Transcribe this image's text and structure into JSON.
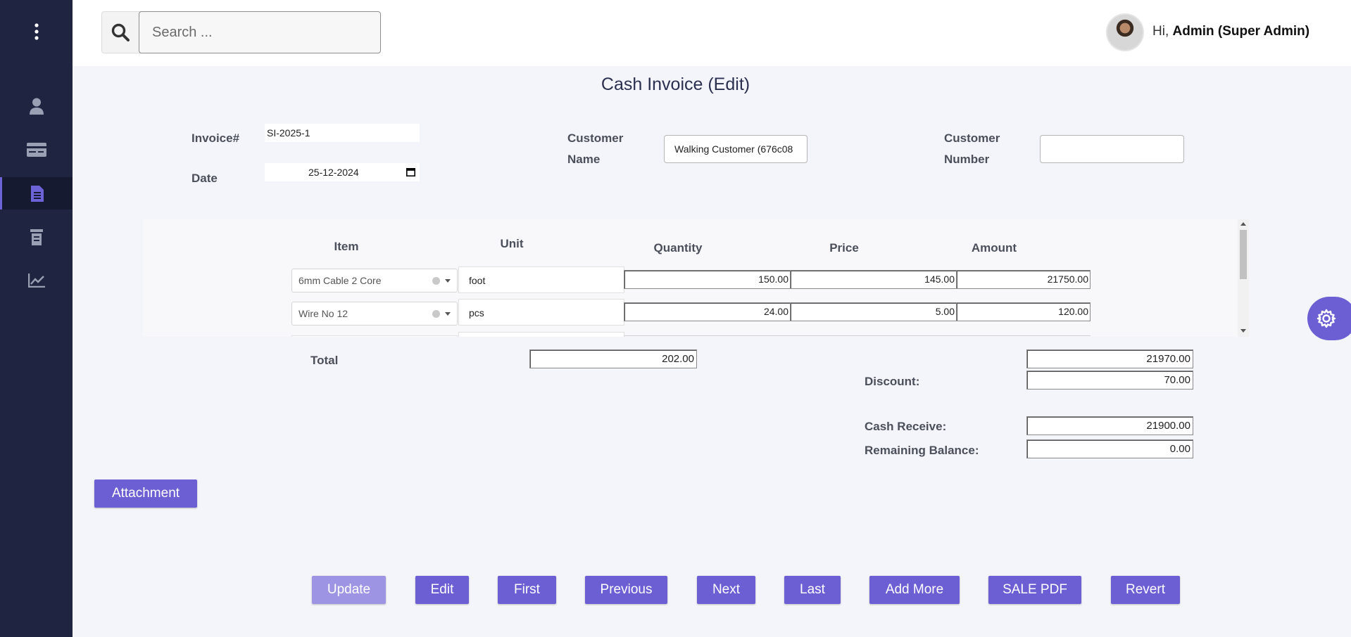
{
  "colors": {
    "accent": "#6c5fd3",
    "sidebar": "#1f2440",
    "background": "#f4f5fa"
  },
  "sidebar": {
    "items": [
      {
        "icon": "user-icon"
      },
      {
        "icon": "card-icon"
      },
      {
        "icon": "invoice-icon",
        "active": true
      },
      {
        "icon": "stack-icon"
      },
      {
        "icon": "chart-icon"
      }
    ]
  },
  "header": {
    "search_placeholder": "Search ...",
    "greeting": "Hi,",
    "user_name": "Admin",
    "role": "(Super Admin)"
  },
  "page_title": "Cash Invoice (Edit)",
  "form": {
    "invoice_label": "Invoice#",
    "invoice_value": "SI-2025-1",
    "date_label": "Date",
    "date_value": "25-12-2024",
    "customer_name_label_1": "Customer",
    "customer_name_label_2": "Name",
    "customer_name_value": "Walking Customer (676c08",
    "customer_number_label_1": "Customer",
    "customer_number_label_2": "Number",
    "customer_number_value": ""
  },
  "table": {
    "headers": {
      "item": "Item",
      "unit": "Unit",
      "quantity": "Quantity",
      "price": "Price",
      "amount": "Amount"
    },
    "rows": [
      {
        "item": "6mm Cable 2 Core",
        "unit": "foot",
        "quantity": "150.00",
        "price": "145.00",
        "amount": "21750.00"
      },
      {
        "item": "Wire No 12",
        "unit": "pcs",
        "quantity": "24.00",
        "price": "5.00",
        "amount": "120.00"
      }
    ]
  },
  "totals": {
    "total_label": "Total",
    "total_quantity": "202.00",
    "total_amount": "21970.00",
    "discount_label": "Discount:",
    "discount": "70.00",
    "cash_receive_label": "Cash Receive:",
    "cash_receive": "21900.00",
    "remaining_label": "Remaining Balance:",
    "remaining": "0.00"
  },
  "buttons": {
    "attachment": "Attachment",
    "update": "Update",
    "edit": "Edit",
    "first": "First",
    "previous": "Previous",
    "next": "Next",
    "last": "Last",
    "add_more": "Add More",
    "sale_pdf": "SALE PDF",
    "revert": "Revert"
  }
}
